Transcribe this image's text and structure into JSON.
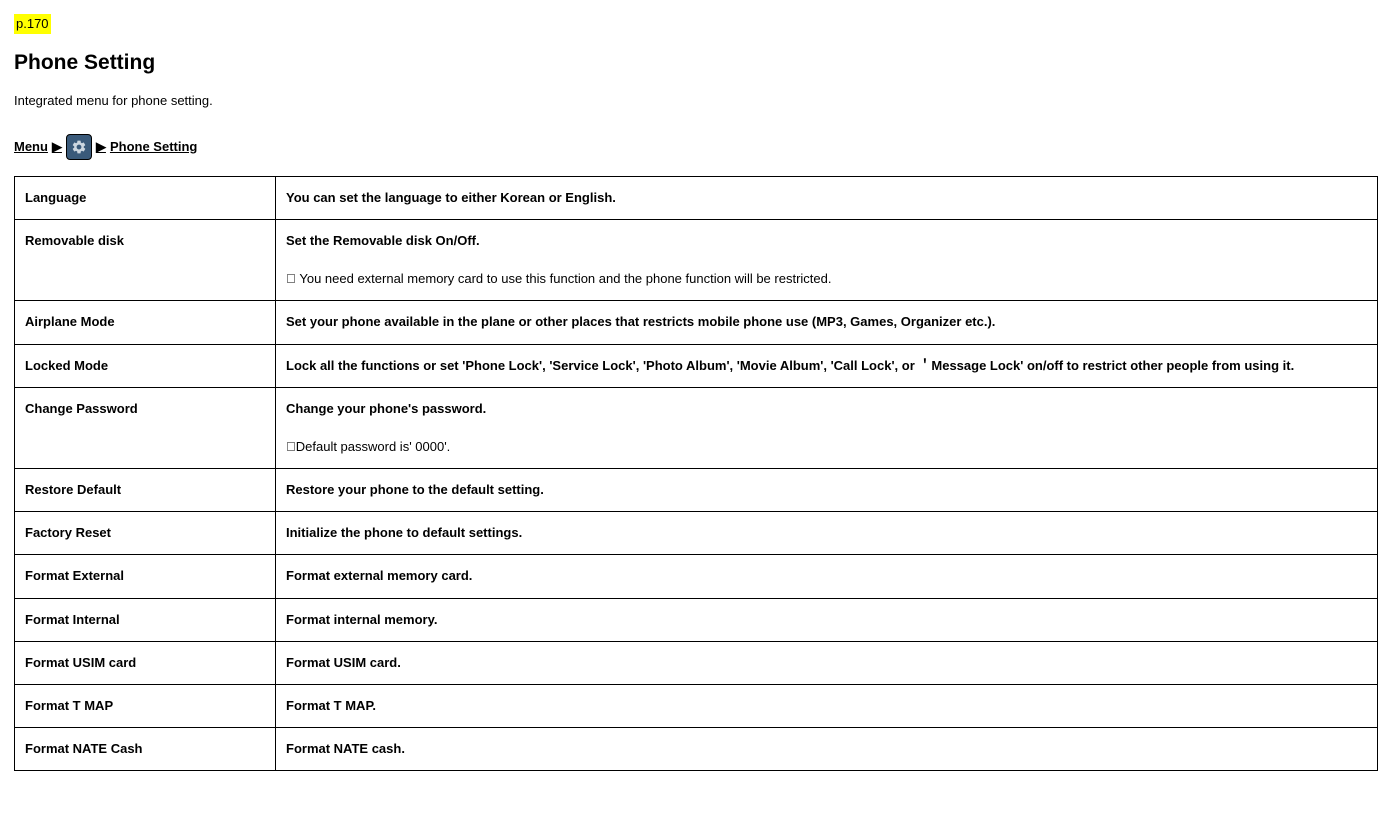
{
  "pageNumber": "p.170",
  "heading": "Phone Setting",
  "subtitle": "Integrated menu for phone setting.",
  "breadcrumb": {
    "part1": "Menu",
    "arrow": "▶",
    "part2": "Phone Setting"
  },
  "rows": [
    {
      "label": "Language",
      "descBold": "You can set the language to either Korean or English.",
      "descNote": ""
    },
    {
      "label": "Removable disk",
      "descBold": "Set the Removable disk On/Off.",
      "descNote": "󰠐 You need external memory card to use this function and the phone function will be restricted."
    },
    {
      "label": "Airplane Mode",
      "descBold": "Set your phone available in the plane or other places that restricts mobile phone use (MP3, Games, Organizer etc.).",
      "descNote": ""
    },
    {
      "label": "Locked Mode",
      "descBold": "Lock all the functions or set 'Phone Lock', 'Service Lock', 'Photo Album', 'Movie Album', 'Call Lock', or ＇Message Lock' on/off to restrict other people from using it.",
      "descNote": ""
    },
    {
      "label": "Change Password",
      "descBold": "Change your phone's password.",
      "descNote": "󰠐Default password is' 0000'."
    },
    {
      "label": "Restore Default",
      "descBold": "Restore your phone to the default setting.",
      "descNote": ""
    },
    {
      "label": "Factory Reset",
      "descBold": "Initialize the phone to default settings.",
      "descNote": ""
    },
    {
      "label": "Format External",
      "descBold": "Format external memory card.",
      "descNote": ""
    },
    {
      "label": "Format Internal",
      "descBold": "Format internal memory.",
      "descNote": ""
    },
    {
      "label": "Format USIM card",
      "descBold": "Format USIM card.",
      "descNote": ""
    },
    {
      "label": "Format T MAP",
      "descBold": "Format T MAP.",
      "descNote": ""
    },
    {
      "label": "Format NATE Cash",
      "descBold": "Format NATE cash.",
      "descNote": ""
    }
  ]
}
